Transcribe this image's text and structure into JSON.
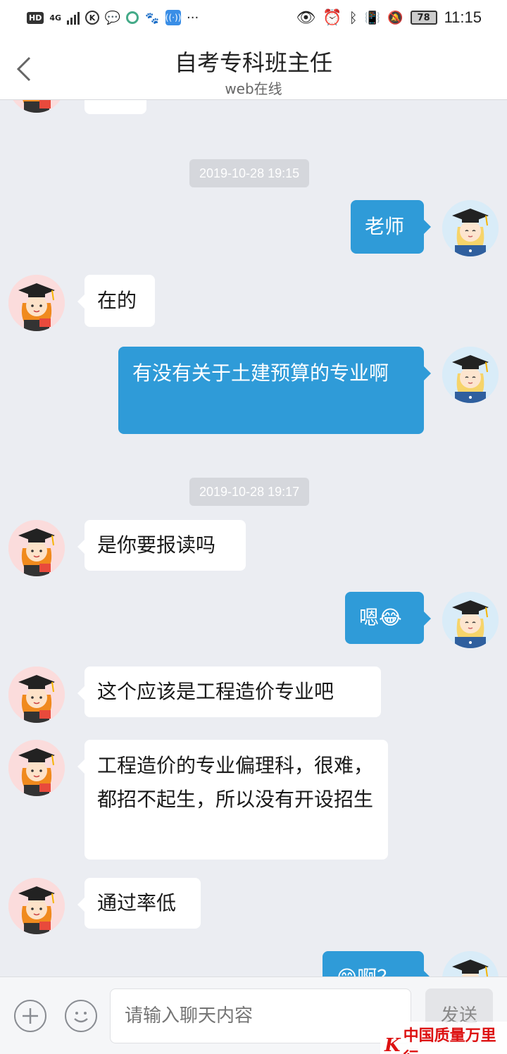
{
  "status_bar": {
    "hd": "HD",
    "network": "4G",
    "battery": "78",
    "time": "11:15"
  },
  "header": {
    "title": "自考专科班主任",
    "subtitle": "web在线"
  },
  "messages": [
    {
      "side": "left",
      "text": ""
    },
    {
      "type": "time",
      "text": "2019-10-28 19:15"
    },
    {
      "side": "right",
      "text": "老师"
    },
    {
      "side": "left",
      "text": "在的"
    },
    {
      "side": "right",
      "text": "有没有关于土建预算的专业啊"
    },
    {
      "type": "time",
      "text": "2019-10-28 19:17"
    },
    {
      "side": "left",
      "text": "是你要报读吗"
    },
    {
      "side": "right",
      "text": "嗯😂"
    },
    {
      "side": "left",
      "text": "这个应该是工程造价专业吧"
    },
    {
      "side": "left",
      "text": "工程造价的专业偏理科，很难，都招不起生，所以没有开设招生"
    },
    {
      "side": "left",
      "text": "通过率低"
    },
    {
      "side": "right",
      "text": "😊啊？"
    }
  ],
  "input": {
    "placeholder": "请输入聊天内容",
    "send_label": "发送"
  },
  "watermark": {
    "text": "中国质量万里行"
  },
  "colors": {
    "bubble_right": "#2f9bd8",
    "bubble_left": "#ffffff",
    "background": "#ebedf2"
  }
}
